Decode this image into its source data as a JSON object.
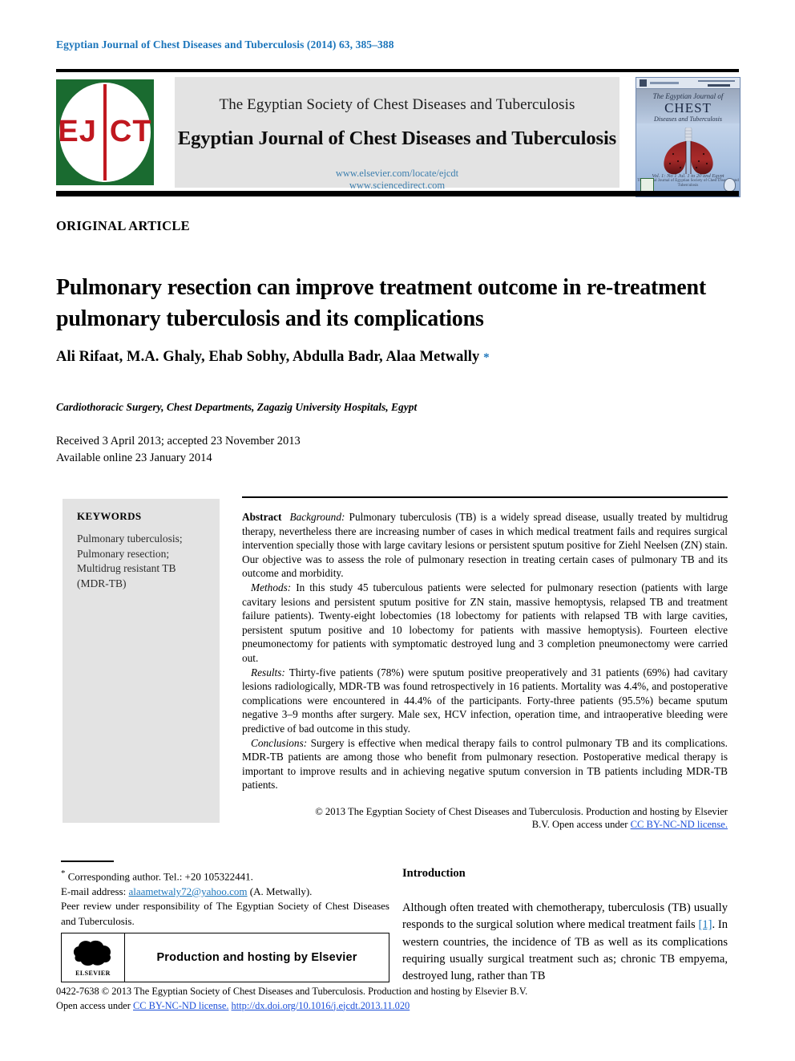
{
  "running_head": "Egyptian Journal of Chest Diseases and Tuberculosis (2014) 63, 385–388",
  "masthead": {
    "logo_text_left": "EJ",
    "logo_text_right": "CT",
    "society_line": "The Egyptian Society of Chest Diseases and Tuberculosis",
    "journal_line": "Egyptian Journal of Chest Diseases and Tuberculosis",
    "url_elsevier": "www.elsevier.com/locate/ejcdt",
    "url_sciencedirect": "www.sciencedirect.com",
    "cover": {
      "title_line1": "The Egyptian Journal of",
      "title_line2": "CHEST",
      "title_line3": "Diseases and Tuberculosis",
      "foot_line1": "Vol. 1: No 1 Jul. 1 to 20 and Egypt",
      "foot_line2": "The Official Journal of Egyptian Society of Chest Diseases and Tuberculosis"
    }
  },
  "article": {
    "kicker": "ORIGINAL ARTICLE",
    "title": "Pulmonary resection can improve treatment outcome in re-treatment pulmonary tuberculosis and its complications",
    "authors": "Ali Rifaat, M.A. Ghaly, Ehab Sobhy, Abdulla Badr, Alaa Metwally",
    "corresponding_marker": "*",
    "affiliation": "Cardiothoracic Surgery, Chest Departments, Zagazig University Hospitals, Egypt",
    "received_line": "Received 3 April 2013; accepted 23 November 2013",
    "available_line": "Available online 23 January 2014"
  },
  "keywords": {
    "heading": "KEYWORDS",
    "items": [
      "Pulmonary tuberculosis;",
      "Pulmonary resection;",
      "Multidrug resistant TB",
      "(MDR-TB)"
    ]
  },
  "abstract": {
    "label": "Abstract",
    "sections": [
      {
        "label": "Background:",
        "text": "Pulmonary tuberculosis (TB) is a widely spread disease, usually treated by multidrug therapy, nevertheless there are increasing number of cases in which medical treatment fails and requires surgical intervention specially those with large cavitary lesions or persistent sputum positive for Ziehl Neelsen (ZN) stain. Our objective was to assess the role of pulmonary resection in treating certain cases of pulmonary TB and its outcome and morbidity."
      },
      {
        "label": "Methods:",
        "text": "In this study 45 tuberculous patients were selected for pulmonary resection (patients with large cavitary lesions and persistent sputum positive for ZN stain, massive hemoptysis, relapsed TB and treatment failure patients). Twenty-eight lobectomies (18 lobectomy for patients with relapsed TB with large cavities, persistent sputum positive and 10 lobectomy for patients with massive hemoptysis). Fourteen elective pneumonectomy for patients with symptomatic destroyed lung and 3 completion pneumonectomy were carried out."
      },
      {
        "label": "Results:",
        "text": "Thirty-five patients (78%) were sputum positive preoperatively and 31 patients (69%) had cavitary lesions radiologically, MDR-TB was found retrospectively in 16 patients. Mortality was 4.4%, and postoperative complications were encountered in 44.4% of the participants. Forty-three patients (95.5%) became sputum negative 3–9 months after surgery. Male sex, HCV infection, operation time, and intraoperative bleeding were predictive of bad outcome in this study."
      },
      {
        "label": "Conclusions:",
        "text": "Surgery is effective when medical therapy fails to control pulmonary TB and its complications. MDR-TB patients are among those who benefit from pulmonary resection. Postoperative medical therapy is important to improve results and in achieving negative sputum conversion in TB patients including MDR-TB patients."
      }
    ],
    "copyright_line1": "© 2013 The Egyptian Society of Chest Diseases and Tuberculosis. Production and hosting by Elsevier",
    "copyright_line2_pre": "B.V. Open access under ",
    "copyright_license": "CC BY-NC-ND license."
  },
  "footnote": {
    "corresponding": "Corresponding author. Tel.: +20 105322441.",
    "email_label": "E-mail address:",
    "email": "alaametwaly72@yahoo.com",
    "email_suffix": "(A. Metwally).",
    "peer_review": "Peer review under responsibility of The Egyptian Society of Chest Diseases and Tuberculosis.",
    "elsevier_banner": "Production and hosting by Elsevier",
    "elsevier_wordmark": "ELSEVIER"
  },
  "introduction": {
    "heading": "Introduction",
    "text_pre": "Although often treated with chemotherapy, tuberculosis (TB) usually responds to the surgical solution where medical treatment fails ",
    "ref": "[1]",
    "text_post": ". In western countries, the incidence of TB as well as its complications requiring usually surgical treatment such as; chronic TB empyema, destroyed lung, rather than TB"
  },
  "bottom_footer": {
    "line1": "0422-7638 © 2013 The Egyptian Society of Chest Diseases and Tuberculosis. Production and hosting by Elsevier B.V.",
    "line2_pre": "Open access under ",
    "license": "CC BY-NC-ND license.",
    "doi": "http://dx.doi.org/10.1016/j.ejcdt.2013.11.020"
  },
  "colors": {
    "running_head_blue": "#1b75bb",
    "logo_green": "#1a6b30",
    "logo_red": "#c0181f",
    "link_blue": "#1b4ed8",
    "panel_gray": "#e3e3e3"
  }
}
